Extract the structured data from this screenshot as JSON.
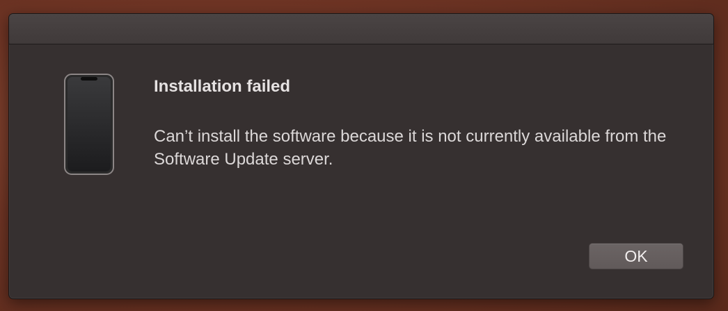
{
  "dialog": {
    "icon": "iphone-device-icon",
    "title": "Installation failed",
    "message": "Can’t install the software because it is not currently available from the Software Update server.",
    "ok_label": "OK"
  },
  "colors": {
    "desktop_background": "#6e3424",
    "dialog_background": "#363030",
    "button_background": "#6b6464",
    "text": "#e6e2e2"
  }
}
